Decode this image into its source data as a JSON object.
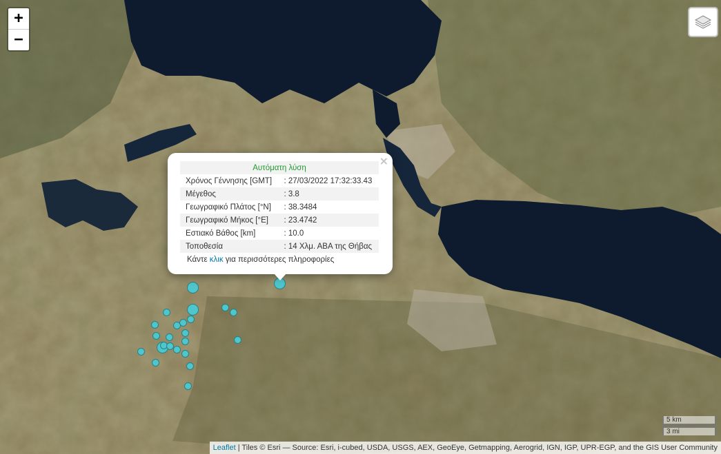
{
  "map": {
    "zoom_in_label": "+",
    "zoom_out_label": "−",
    "layers_icon": "layers-icon"
  },
  "popup": {
    "close_label": "×",
    "title": "Αυτόματη λύση",
    "rows": [
      {
        "label": "Χρόνος Γέννησης [GMT]",
        "value": ": 27/03/2022 17:32:33.43"
      },
      {
        "label": "Μέγεθος",
        "value": ": 3.8"
      },
      {
        "label": "Γεωγραφικό Πλάτος [°N]",
        "value": ": 38.3484"
      },
      {
        "label": "Γεωγραφικό Μήκος [°E]",
        "value": ": 23.4742"
      },
      {
        "label": "Εστιακό Βάθος [km]",
        "value": ": 10.0"
      },
      {
        "label": "Τοποθεσία",
        "value": ": 14 Χλμ. ΑΒΑ της Θήβας"
      }
    ],
    "more_prefix": "Κάντε ",
    "more_link": "κλικ",
    "more_suffix": " για περισσότερες πληροφορίες"
  },
  "scale": {
    "metric": "5 km",
    "imperial": "3 mi"
  },
  "attribution": {
    "leaflet": "Leaflet",
    "text": " | Tiles © Esri — Source: Esri, i-cubed, USDA, USGS, AEX, GeoEye, Getmapping, Aerogrid, IGN, IGP, UPR-EGP, and the GIS User Community"
  },
  "colors": {
    "marker_fill": "#4fc6cc",
    "popup_title": "#1f9a2e",
    "link": "#0078a8"
  }
}
